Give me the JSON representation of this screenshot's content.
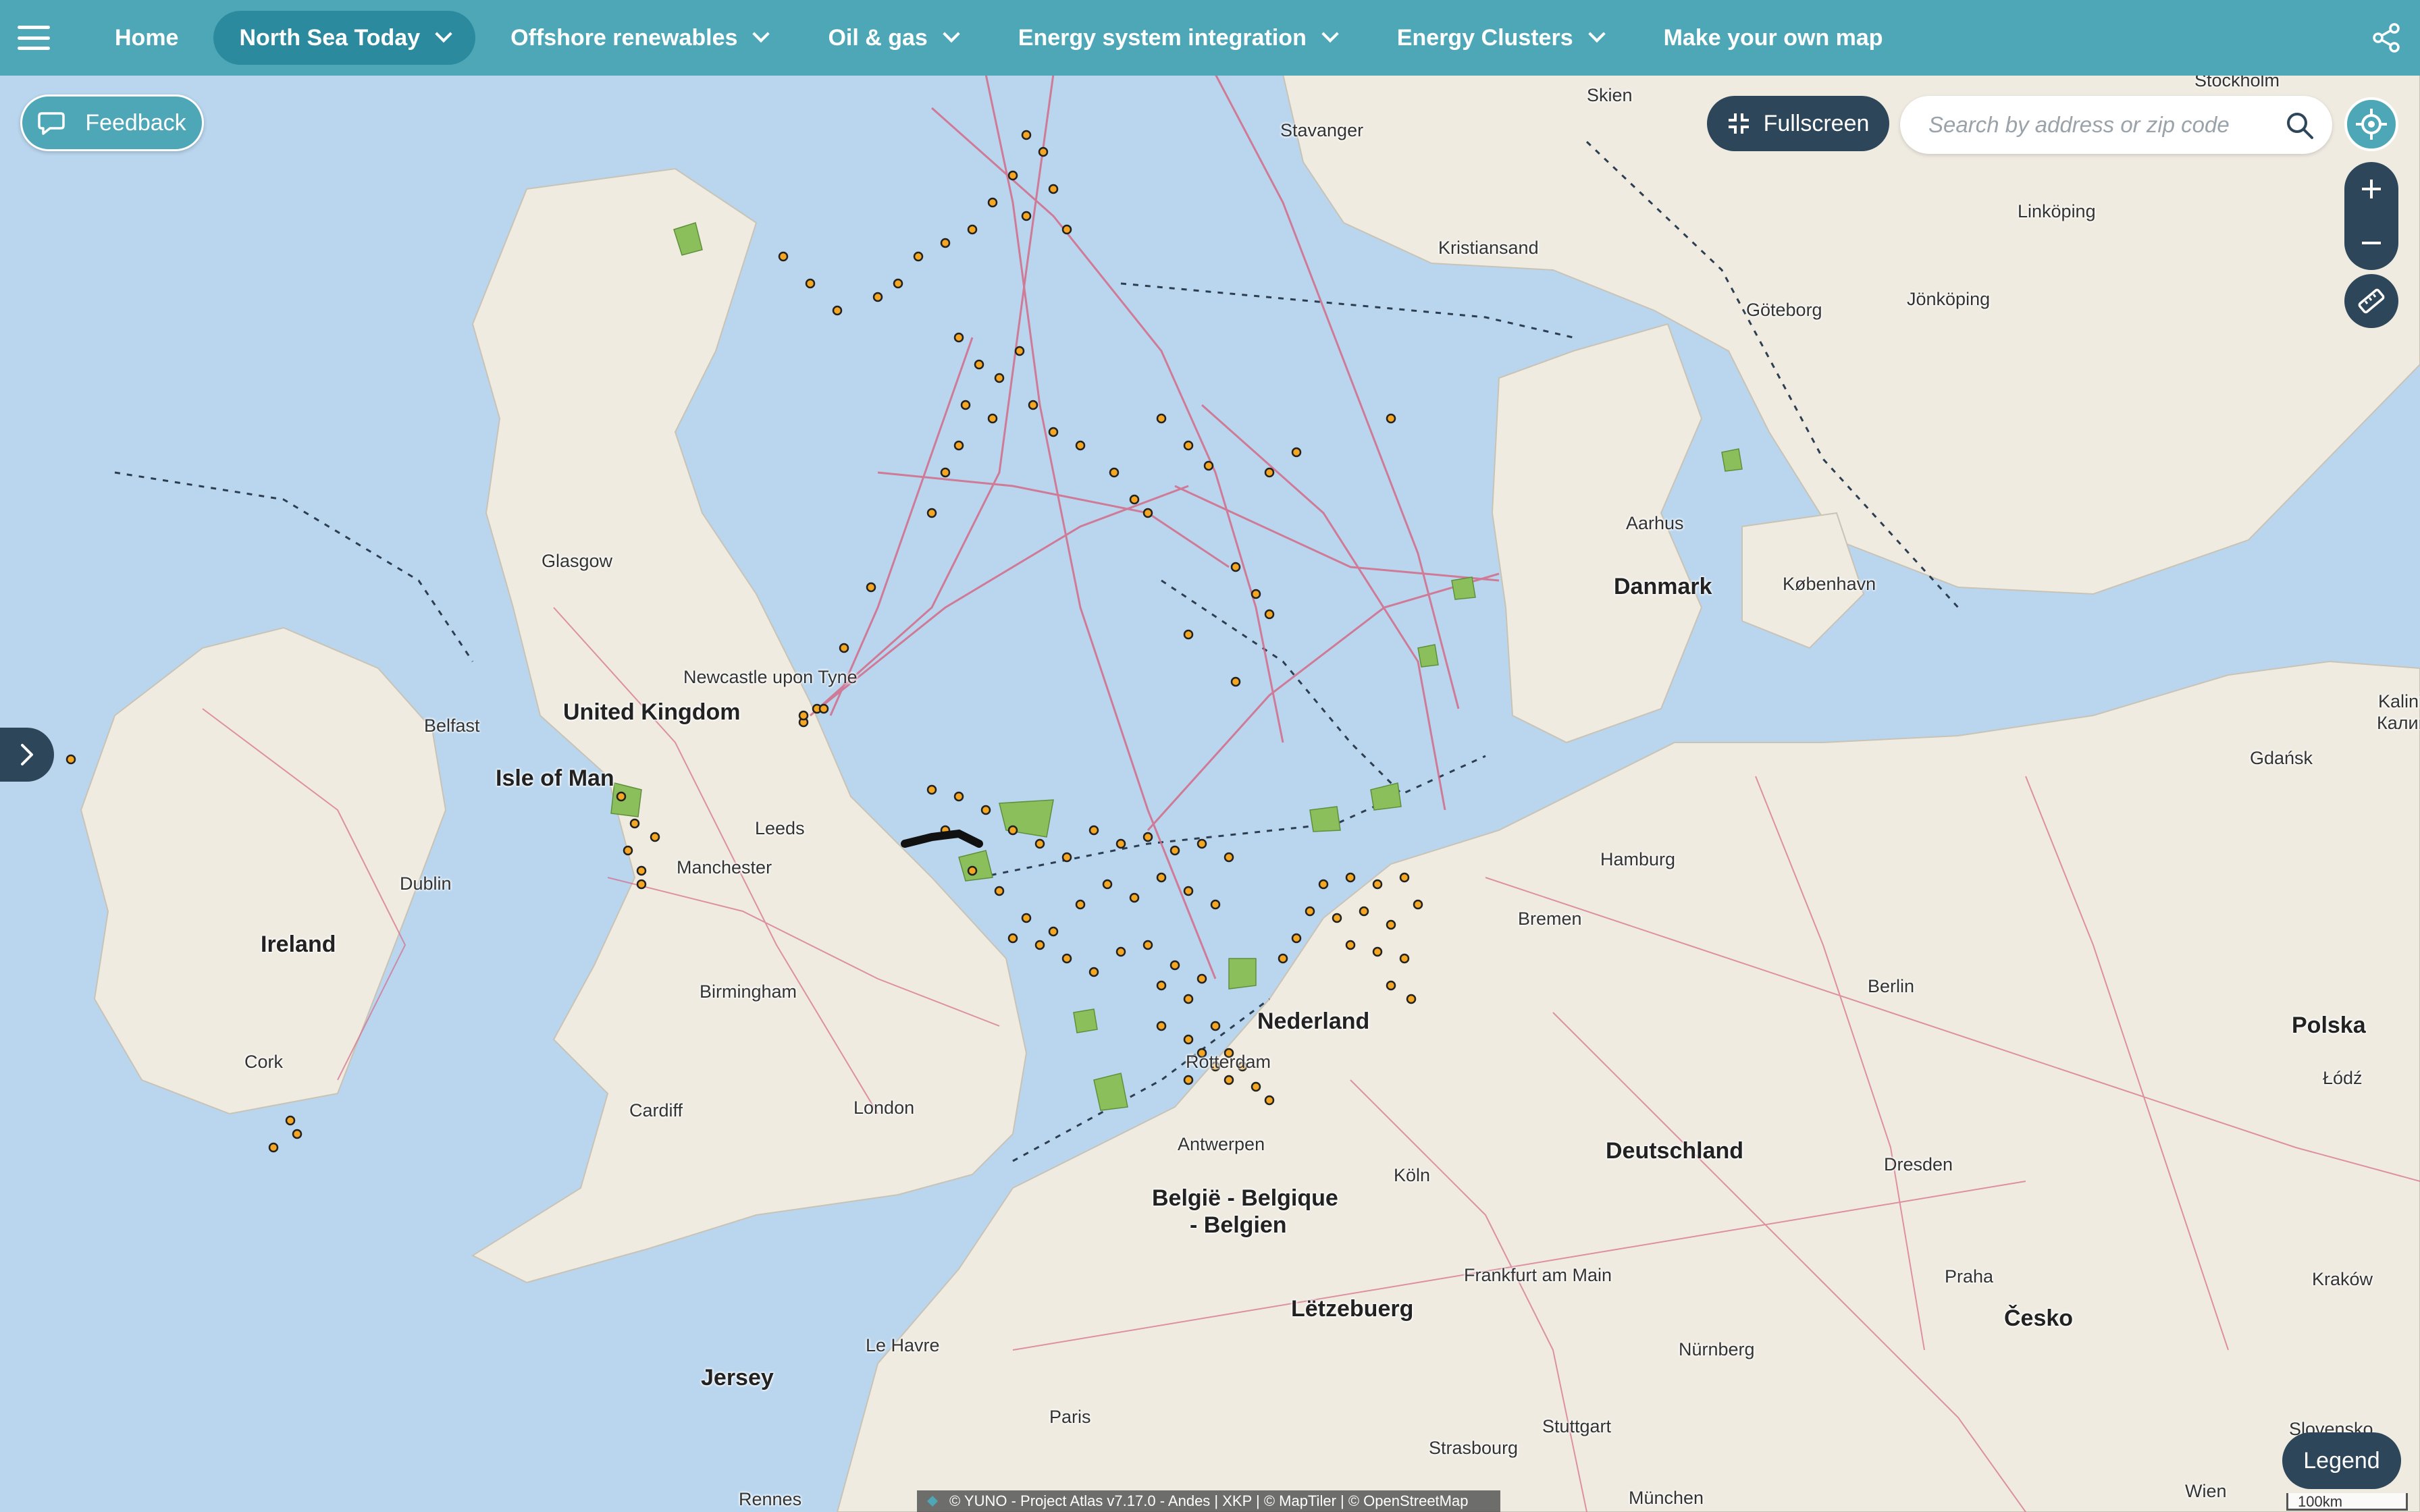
{
  "nav": {
    "menu_icon": "hamburger-menu-icon",
    "items": [
      {
        "label": "Home",
        "dropdown": false,
        "active": false
      },
      {
        "label": "North Sea Today",
        "dropdown": true,
        "active": true
      },
      {
        "label": "Offshore renewables",
        "dropdown": true,
        "active": false
      },
      {
        "label": "Oil & gas",
        "dropdown": true,
        "active": false
      },
      {
        "label": "Energy system integration",
        "dropdown": true,
        "active": false
      },
      {
        "label": "Energy Clusters",
        "dropdown": true,
        "active": false
      },
      {
        "label": "Make your own map",
        "dropdown": false,
        "active": false
      }
    ],
    "share_icon": "share-icon"
  },
  "controls": {
    "feedback_label": "Feedback",
    "fullscreen_label": "Fullscreen",
    "search_placeholder": "Search by address or zip code",
    "legend_label": "Legend",
    "locate_icon": "crosshair-icon",
    "zoom_in_icon": "plus-icon",
    "zoom_out_icon": "minus-icon",
    "measure_icon": "ruler-icon",
    "sidebar_toggle_icon": "chevron-right-icon"
  },
  "attribution": "© YUNO - Project Atlas v7.17.0 - Andes  |  XKP  |  © MapTiler  |  © OpenStreetMap",
  "scale_label": "100km",
  "colors": {
    "topbar": "#4ea7b7",
    "nav_active": "#2b8a9d",
    "dark_button": "#2d4659",
    "sea": "#b9d6ee",
    "land": "#efebe1",
    "wind_farm": "#8bbf5c",
    "pipeline": "#d46a87",
    "well_marker": "#f5a623"
  },
  "map": {
    "countries": [
      "United Kingdom",
      "Isle of Man",
      "Ireland",
      "Danmark",
      "Nederland",
      "Deutschland",
      "België - Belgique",
      "- Belgien",
      "Lëtzebuerg",
      "Jersey",
      "Polska",
      "Česko"
    ],
    "places": [
      "Stavanger",
      "Skien",
      "Kristiansand",
      "Linköping",
      "Jönköping",
      "Göteborg",
      "Aarhus",
      "København",
      "Glasgow",
      "Newcastle upon Tyne",
      "Belfast",
      "Dublin",
      "Leeds",
      "Manchester",
      "Birmingham",
      "Cardiff",
      "London",
      "Cork",
      "Antwerpen",
      "Köln",
      "Bremen",
      "Hamburg",
      "Berlin",
      "Dresden",
      "Frankfurt am Main",
      "Praha",
      "Nürnberg",
      "Stuttgart",
      "Strasbourg",
      "Le Havre",
      "Paris",
      "Rennes",
      "München",
      "Wien",
      "Kraków",
      "Łódź",
      "Gdańsk",
      "Stockholm",
      "Kalini",
      "Калин",
      "Rotterdam",
      "Slovensko"
    ]
  }
}
